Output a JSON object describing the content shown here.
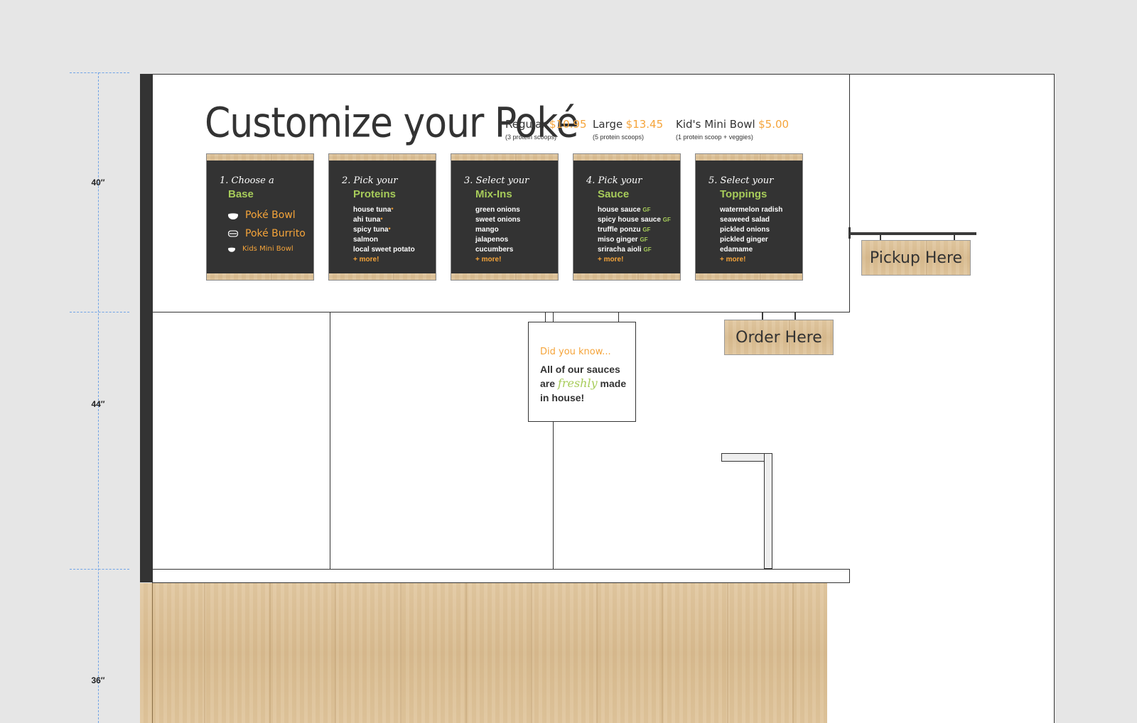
{
  "dimensions": [
    "40″",
    "44″",
    "36″"
  ],
  "menu": {
    "title": "Customize your Poké",
    "sizes": [
      {
        "name": "Regular",
        "price": "$10.95",
        "note": "(3 protein scoops)"
      },
      {
        "name": "Large",
        "price": "$13.45",
        "note": "(5 protein scoops)"
      },
      {
        "name": "Kid's Mini Bowl",
        "price": "$5.00",
        "note": "(1 protein scoop + veggies)"
      }
    ],
    "steps": [
      {
        "step": "1. Choose a",
        "name": "Base",
        "items": [
          "Poké Bowl",
          "Poké Burrito",
          "Kids Mini Bowl"
        ]
      },
      {
        "step": "2. Pick your",
        "name": "Proteins",
        "items": [
          "house tuna",
          "ahi tuna",
          "spicy tuna",
          "salmon",
          "local sweet potato"
        ],
        "more": "+ more!"
      },
      {
        "step": "3. Select your",
        "name": "Mix-Ins",
        "items": [
          "green onions",
          "sweet onions",
          "mango",
          "jalapenos",
          "cucumbers"
        ],
        "more": "+ more!"
      },
      {
        "step": "4. Pick your",
        "name": "Sauce",
        "items": [
          "house sauce",
          "spicy house sauce",
          "truffle ponzu",
          "miso ginger",
          "sriracha aioli"
        ],
        "gf": "GF",
        "more": "+ more!"
      },
      {
        "step": "5. Select your",
        "name": "Toppings",
        "items": [
          "watermelon radish",
          "seaweed salad",
          "pickled onions",
          "pickled ginger",
          "edamame"
        ],
        "more": "+ more!"
      }
    ]
  },
  "did_you_know": {
    "heading": "Did you know...",
    "line1": "All of our sauces",
    "are": "are",
    "freshly": "freshly",
    "made": "made",
    "line3": "in house!"
  },
  "signs": {
    "pickup": "Pickup Here",
    "order": "Order Here"
  },
  "colors": {
    "accent_orange": "#f5a43a",
    "accent_green": "#a7cc5a",
    "chalkboard": "#333333",
    "wood": "#dcc197"
  }
}
